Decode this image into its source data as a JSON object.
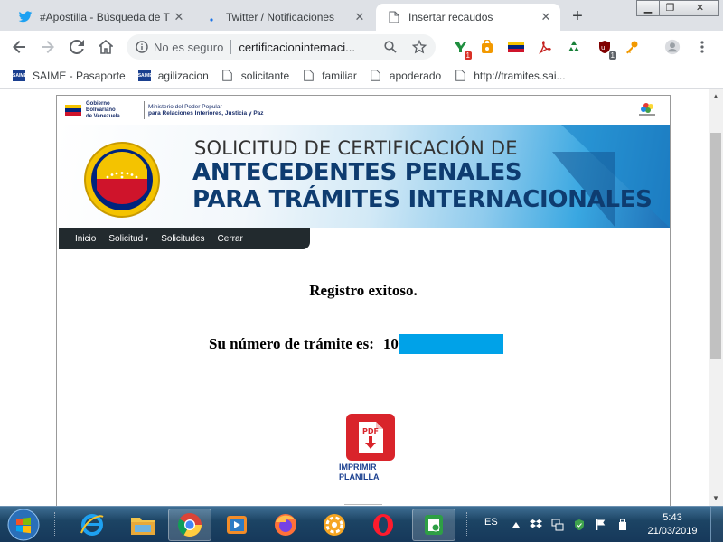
{
  "browser": {
    "tabs": [
      {
        "title": "#Apostilla - Búsqueda de T",
        "favicon": "twitter-bird-icon",
        "active": false
      },
      {
        "title": "Twitter / Notificaciones",
        "favicon": "loading-dot-icon",
        "active": false
      },
      {
        "title": "Insertar recaudos",
        "favicon": "document-icon",
        "active": true
      }
    ],
    "new_tab_label": "+",
    "security_label": "No es seguro",
    "url": "certificacioninternaci...",
    "bookmarks": [
      {
        "label": "SAIME - Pasaporte",
        "icon": "saime-icon"
      },
      {
        "label": "agilizacion",
        "icon": "saime-icon"
      },
      {
        "label": "solicitante",
        "icon": "page-icon"
      },
      {
        "label": "familiar",
        "icon": "page-icon"
      },
      {
        "label": "apoderado",
        "icon": "page-icon"
      },
      {
        "label": "http://tramites.sai...",
        "icon": "page-icon"
      }
    ],
    "extension_badges": {
      "first": "1",
      "second": "1"
    }
  },
  "page": {
    "gov": {
      "line1": "Gobierno",
      "line2": "Bolivariano",
      "line3": "de Venezuela",
      "ministry_line1": "Ministerio del Poder Popular",
      "ministry_line2": "para Relaciones Interiores, Justicia y Paz"
    },
    "banner": {
      "line1": "SOLICITUD DE CERTIFICACIÓN DE",
      "line2": "ANTECEDENTES PENALES",
      "line3": "PARA TRÁMITES INTERNACIONALES"
    },
    "menu": {
      "inicio": "Inicio",
      "solicitud": "Solicitud",
      "solicitudes": "Solicitudes",
      "cerrar": "Cerrar"
    },
    "success_message": "Registro exitoso.",
    "tramite_label": "Su número de trámite es:",
    "tramite_number_visible": "10",
    "print_label_line1": "IMPRIMIR",
    "print_label_line2": "PLANILLA",
    "pdf_badge": "PDF"
  },
  "taskbar": {
    "language": "ES",
    "time": "5:43",
    "date": "21/03/2019"
  },
  "colors": {
    "accent_blue": "#0e3c70",
    "redaction": "#00a2e8",
    "pdf_red": "#d9242b",
    "menu_bg": "#222a2e"
  }
}
